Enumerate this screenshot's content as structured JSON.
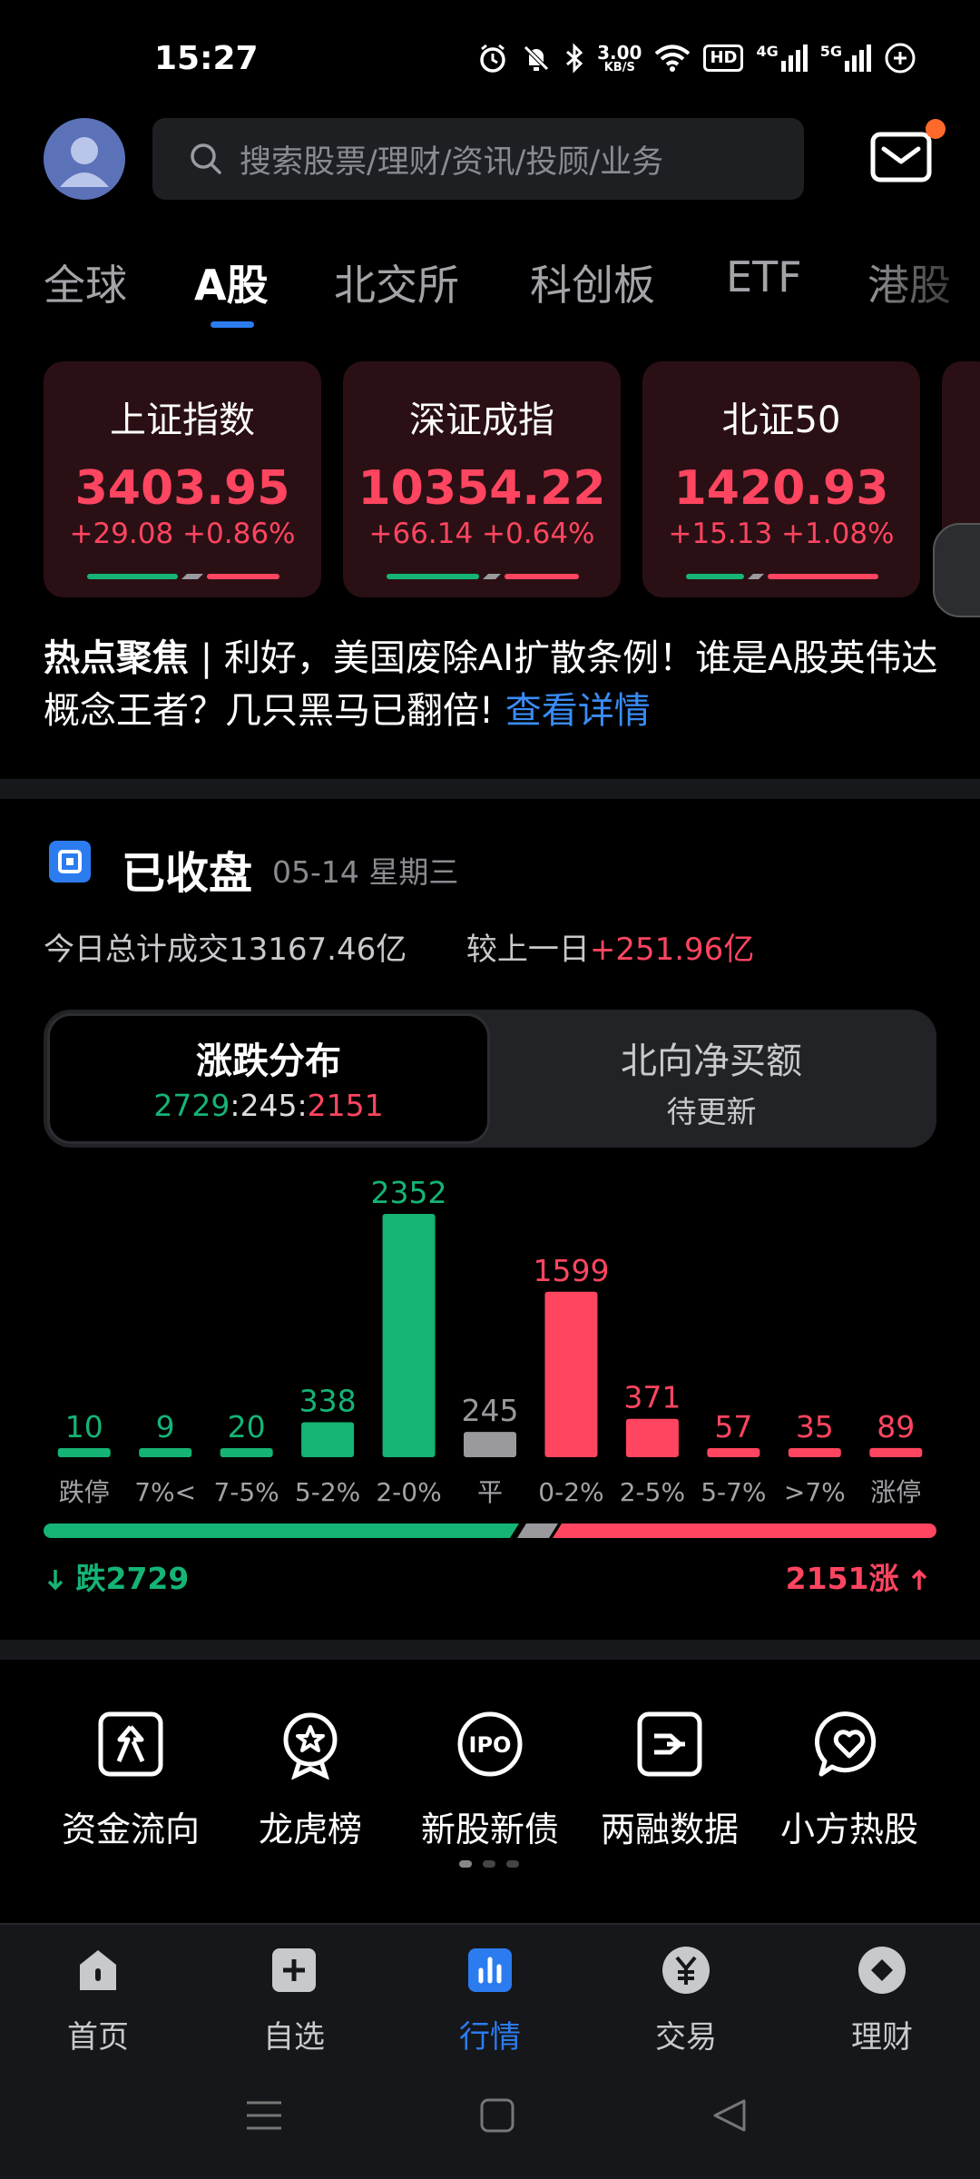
{
  "status_bar": {
    "time": "15:27",
    "net_speed_value": "3.00",
    "net_speed_unit": "KB/S",
    "hd_label": "HD",
    "signal1_label": "4G",
    "signal2_label": "5G",
    "icons": [
      "alarm-icon",
      "mute-icon",
      "bluetooth-icon",
      "wifi-icon",
      "hd-icon",
      "signal-4g-icon",
      "signal-5g-icon",
      "battery-icon"
    ]
  },
  "header": {
    "search_placeholder": "搜索股票/理财/资讯/投顾/业务",
    "icons": [
      "avatar",
      "search-icon",
      "mail-icon"
    ],
    "mail_badge_color": "#ff6a2b"
  },
  "tabs": [
    "全球",
    "A股",
    "北交所",
    "科创板",
    "ETF",
    "港股"
  ],
  "active_tab": "A股",
  "indices": [
    {
      "name": "上证指数",
      "value": "3403.95",
      "change": "+29.08 +0.86%"
    },
    {
      "name": "深证成指",
      "value": "10354.22",
      "change": "+66.14 +0.64%"
    },
    {
      "name": "北证50",
      "value": "1420.93",
      "change": "+15.13 +1.08%"
    }
  ],
  "hot_news": {
    "tag": "热点聚焦",
    "separator": " | ",
    "text": "利好，美国废除AI扩散条例！谁是A股英伟达概念王者？几只黑马已翻倍!",
    "link": "查看详情"
  },
  "market": {
    "status": "已收盘",
    "date": "05-14 星期三",
    "turnover_label": "今日总计成交",
    "turnover_value": "13167.46亿",
    "compare_label": "较上一日",
    "compare_value": "+251.96亿"
  },
  "segment": {
    "left_title": "涨跌分布",
    "left_fall": "2729",
    "left_flat": "245",
    "left_rise": "2151",
    "colon": ":",
    "right_title": "北向净买额",
    "right_sub": "待更新"
  },
  "chart_data": {
    "type": "bar",
    "categories": [
      "跌停",
      "7%<",
      "7-5%",
      "5-2%",
      "2-0%",
      "平",
      "0-2%",
      "2-5%",
      "5-7%",
      ">7%",
      "涨停"
    ],
    "values": [
      10,
      9,
      20,
      338,
      2352,
      245,
      1599,
      371,
      57,
      35,
      89
    ],
    "colors": [
      "#15b475",
      "#15b475",
      "#15b475",
      "#15b475",
      "#15b475",
      "#9a9a9e",
      "#ff4560",
      "#ff4560",
      "#ff4560",
      "#ff4560",
      "#ff4560"
    ],
    "fall_total_label": "跌2729",
    "rise_total_label": "2151涨",
    "fall_total": 2729,
    "flat_total": 245,
    "rise_total": 2151
  },
  "quick_entries": [
    {
      "label": "资金流向",
      "icon": "fund-flow-icon"
    },
    {
      "label": "龙虎榜",
      "icon": "dragon-tiger-icon"
    },
    {
      "label": "新股新债",
      "icon": "ipo-icon"
    },
    {
      "label": "两融数据",
      "icon": "margin-data-icon"
    },
    {
      "label": "小方热股",
      "icon": "hot-stock-icon"
    }
  ],
  "ipo_icon_text": "IPO",
  "bottom_nav": [
    {
      "label": "首页",
      "icon": "home-icon"
    },
    {
      "label": "自选",
      "icon": "watchlist-icon"
    },
    {
      "label": "行情",
      "icon": "market-icon"
    },
    {
      "label": "交易",
      "icon": "trade-icon"
    },
    {
      "label": "理财",
      "icon": "wealth-icon"
    }
  ],
  "active_nav": "行情",
  "colors": {
    "rise": "#ff4560",
    "fall": "#15b475",
    "flat": "#9a9a9e",
    "accent": "#2c7cf0",
    "link": "#3a8cf6"
  }
}
